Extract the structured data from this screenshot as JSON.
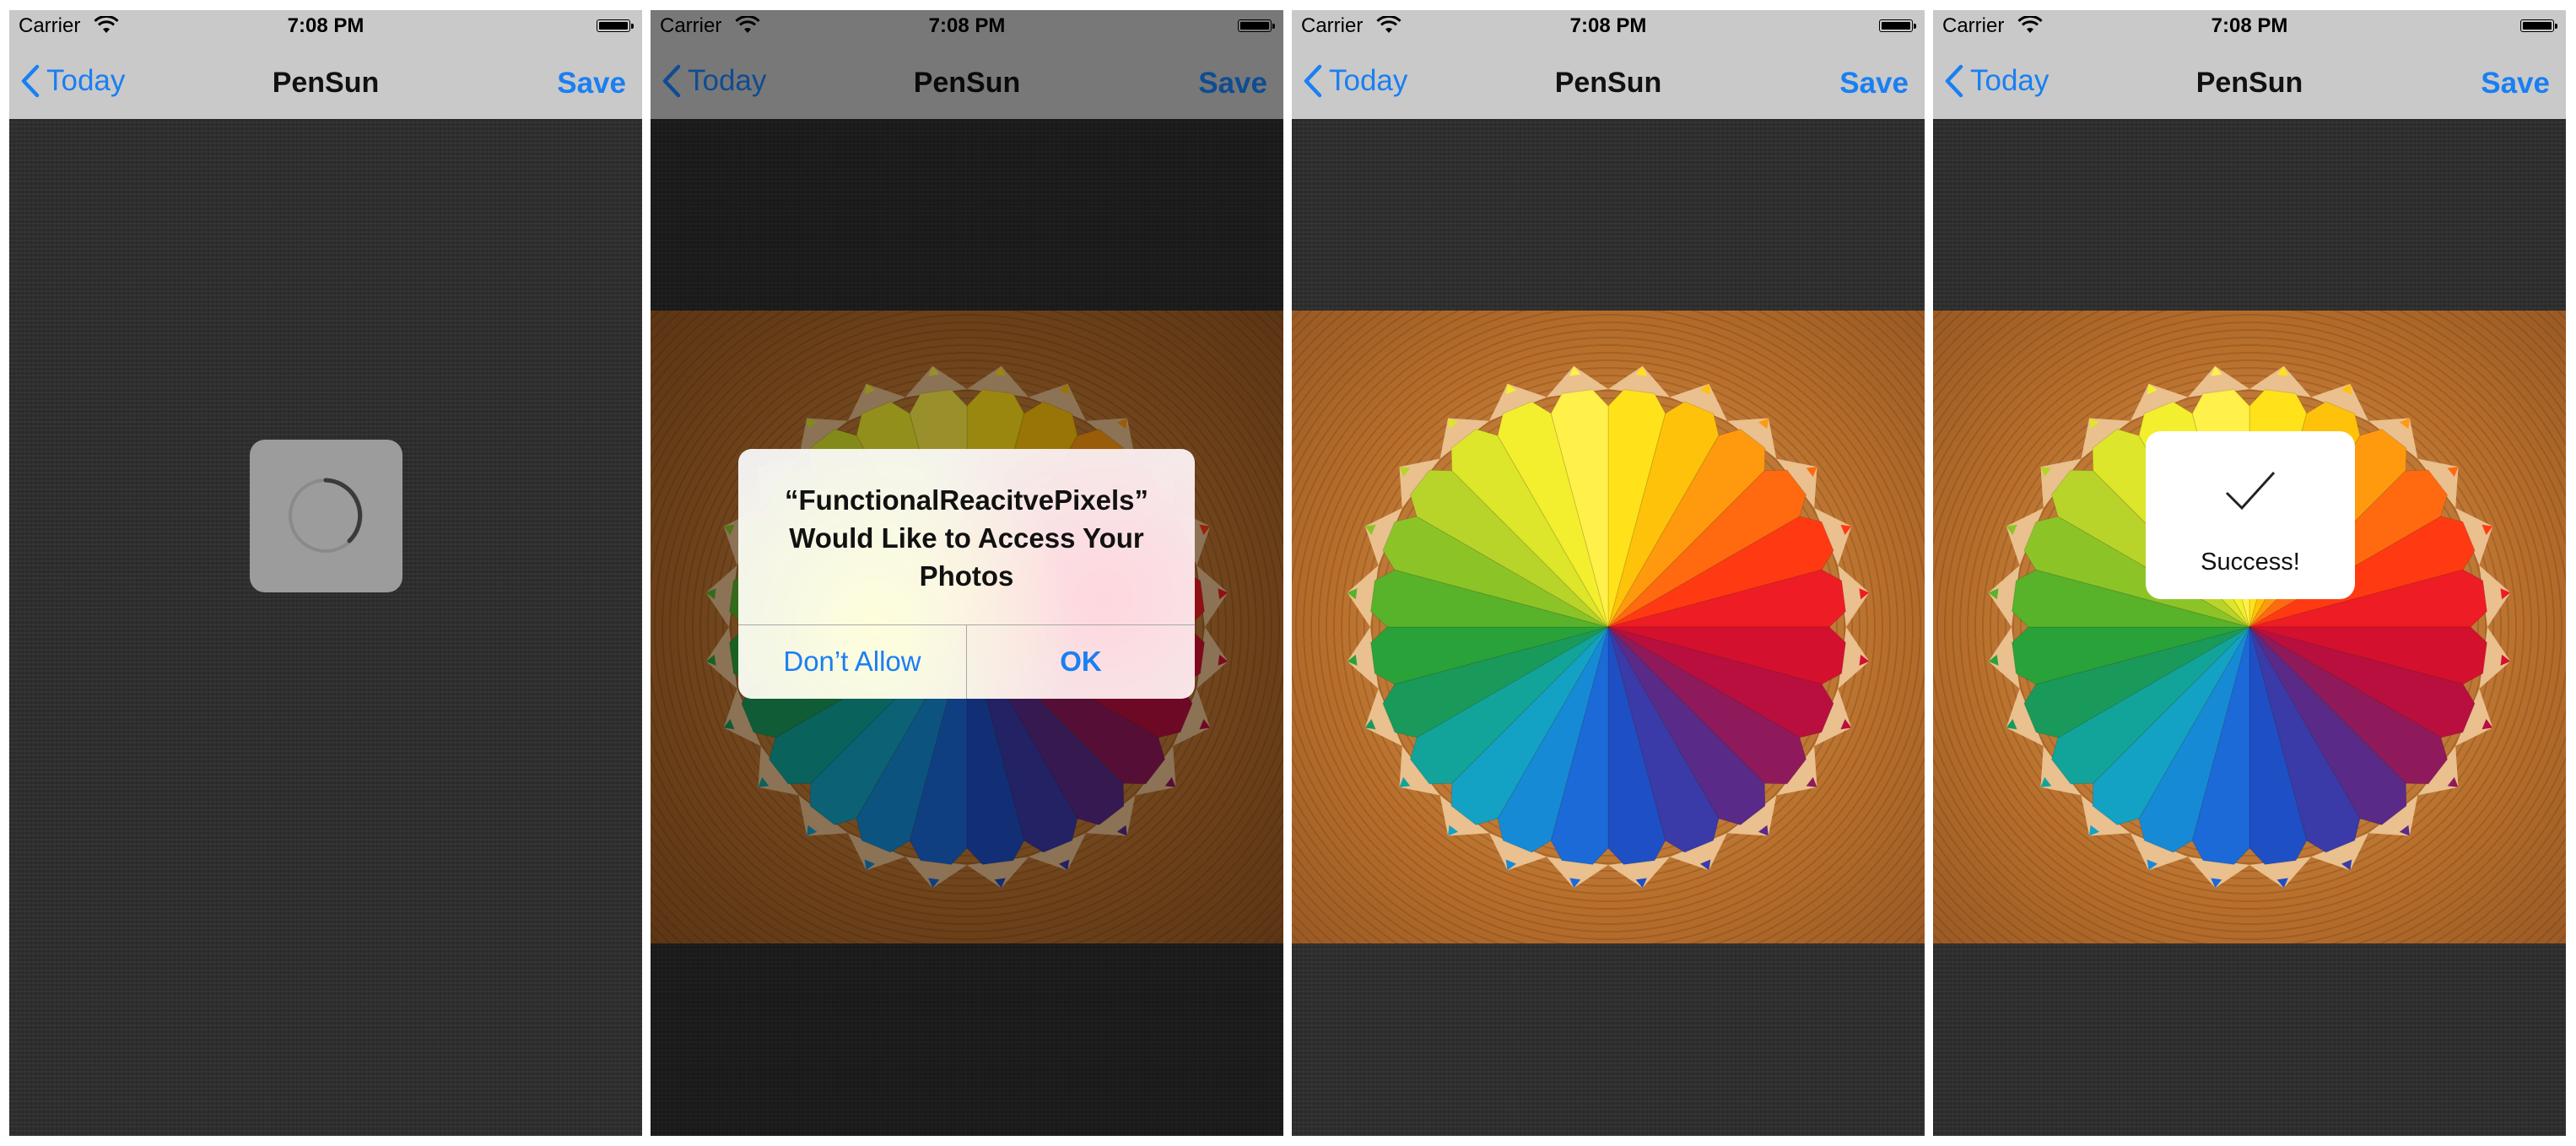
{
  "status": {
    "carrier": "Carrier",
    "time": "7:08 PM"
  },
  "nav": {
    "back_label": "Today",
    "title": "PenSun",
    "save_label": "Save"
  },
  "alert": {
    "title_line1": "“FunctionalReacitvePixels”",
    "title_line2": "Would Like to Access Your",
    "title_line3": "Photos",
    "deny_label": "Don’t Allow",
    "ok_label": "OK"
  },
  "hud": {
    "message": "Success!"
  },
  "colors": {
    "accent": "#1a7ff2",
    "bar": "#c9c9c9",
    "background": "#2e2e2e",
    "pencils": [
      "#ffe21a",
      "#ffc20a",
      "#ff9a0f",
      "#ff6a10",
      "#ff3a12",
      "#ee1c24",
      "#d4102f",
      "#b80f3e",
      "#8e1a5c",
      "#5a2a88",
      "#3a3aa8",
      "#1f4fc4",
      "#1b6ad8",
      "#178ad6",
      "#14a2c4",
      "#12a49a",
      "#1a9a5a",
      "#2aa23a",
      "#58b22a",
      "#8cc428",
      "#b8d42a",
      "#dde62a",
      "#f3ef2e",
      "#fff04a"
    ]
  }
}
